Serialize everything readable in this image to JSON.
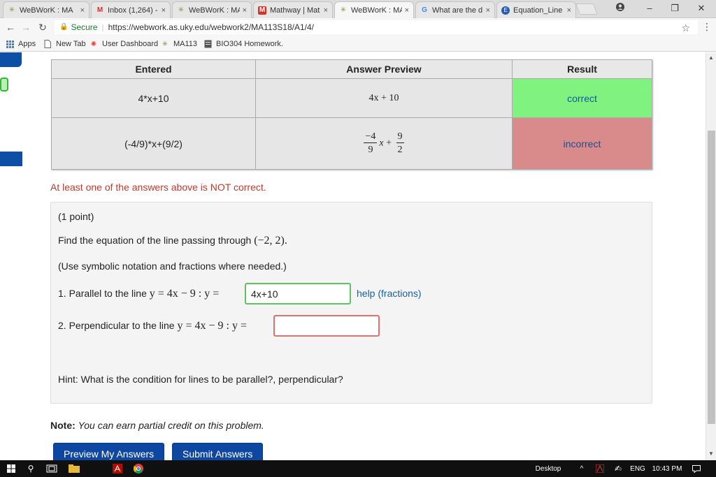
{
  "browser": {
    "tabs": [
      {
        "label": "WeBWorK : MA",
        "icon": "webwork-icon",
        "active": false
      },
      {
        "label": "Inbox (1,264) -",
        "icon": "gmail-icon",
        "active": false
      },
      {
        "label": "WeBWorK : MA",
        "icon": "webwork-icon",
        "active": false
      },
      {
        "label": "Mathway | Mat",
        "icon": "mathway-icon",
        "active": false
      },
      {
        "label": "WeBWorK : MA",
        "icon": "webwork-icon",
        "active": true
      },
      {
        "label": "What are the d",
        "icon": "google-icon",
        "active": false
      },
      {
        "label": "Equation_Line",
        "icon": "doc-icon",
        "active": false
      }
    ],
    "close_glyph": "×",
    "window": {
      "minimize": "–",
      "restore": "❐",
      "close": "✕"
    },
    "address": {
      "secure_label": "Secure",
      "url": "https://webwork.as.uky.edu/webwork2/MA113S18/A1/4/"
    },
    "bookmarks": [
      "Apps",
      "New Tab",
      "User Dashboard",
      "MA113",
      "BIO304 Homework."
    ]
  },
  "results": {
    "headers": [
      "Entered",
      "Answer Preview",
      "Result"
    ],
    "rows": [
      {
        "entered": "4*x+10",
        "result": "correct"
      },
      {
        "entered": "(-4/9)*x+(9/2)",
        "result": "incorrect"
      }
    ],
    "preview1": "4x + 10",
    "preview2": {
      "num1": "−4",
      "den1": "9",
      "x": "x",
      "plus": "+",
      "num2": "9",
      "den2": "2"
    }
  },
  "warning": "At least one of the answers above is NOT correct.",
  "problem": {
    "points": "(1 point)",
    "statement_prefix": "Find the equation of the line passing through",
    "point": "(−2, 2).",
    "instructions": "(Use symbolic notation and fractions where needed.)",
    "q1_prefix": "1. Parallel to the line",
    "q1_math": "y = 4x − 9 : y =",
    "q1_value": "4x+10",
    "help_link": "help (fractions)",
    "q2_prefix": "2. Perpendicular to the line",
    "q2_math": "y = 4x − 9 : y =",
    "q2_value": "",
    "hint": "Hint: What is the condition for lines to be parallel?, perpendicular?"
  },
  "note": {
    "label": "Note:",
    "text": "You can earn partial credit on this problem."
  },
  "buttons": {
    "preview": "Preview My Answers",
    "submit": "Submit Answers"
  },
  "taskbar": {
    "desktop": "Desktop",
    "lang": "ENG",
    "time": "10:43 PM"
  },
  "colors": {
    "correct": "#7ff27f",
    "incorrect": "#d98b8b",
    "button": "#0d47a1",
    "warning": "#c0392b"
  }
}
